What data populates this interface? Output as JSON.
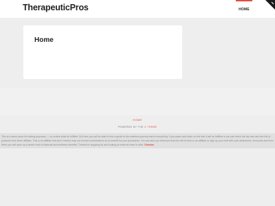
{
  "header": {
    "site_title": "TherapeuticPros",
    "nav": [
      {
        "label": "HOME"
      }
    ]
  },
  "main": {
    "page_title": "Home"
  },
  "footer": {
    "home_link": "HOME",
    "powered_prefix": "POWERED BY THE",
    "powered_brand": "X THEME"
  },
  "disclaimer": {
    "text": "This is a demo store for testing purposes — no orders shall be fulfilled. But here you will be able to find a guide to the wellness journey that is everything. If you place and order on the site it will be fulfilled or we just check the link and are free full of products from there affiliate. This is an affiliate link and I receive may not receive commissions at no benefit for your purchases. You can also opt reference that this did at click or an affiliate or sign up your self with such awareness. Accounts and from there you will open up a whole host of financial and wellness benefits. Thanks for stopping by and looking at what we have to offer.",
    "dismiss_label": "Dismiss"
  },
  "colors": {
    "accent": "#e34c3d",
    "background": "#eeeeee",
    "card": "#ffffff"
  }
}
